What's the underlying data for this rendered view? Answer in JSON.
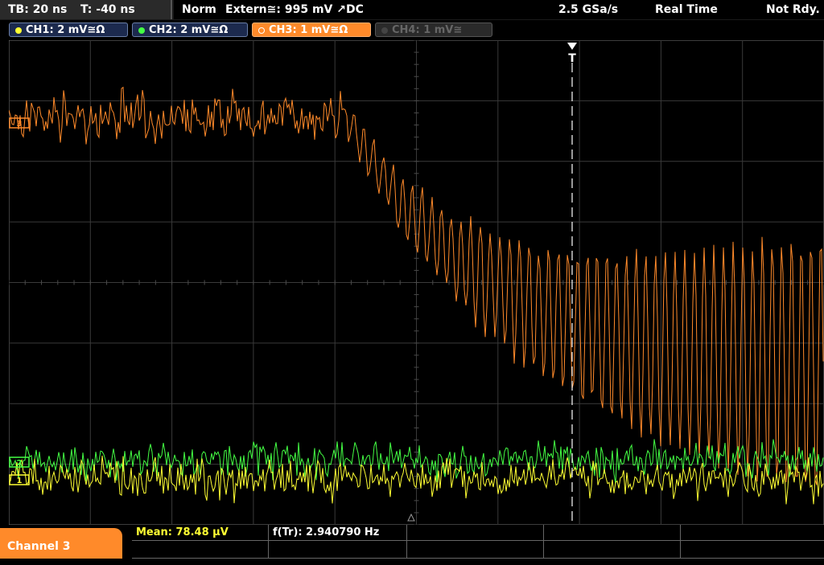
{
  "topbar": {
    "timebase": "TB: 20 ns",
    "trigger_time": "T: -40 ns",
    "trigger_mode": "Norm",
    "trigger_source": "Extern≅: 995 mV ↗DC",
    "sample_rate": "2.5 GSa/s",
    "acquisition_mode": "Real Time",
    "ready_state": "Not Rdy."
  },
  "channels": [
    {
      "label": "CH1: 2 mV≅Ω",
      "color": "#ffff33",
      "active": true
    },
    {
      "label": "CH2: 2 mV≅Ω",
      "color": "#44ff44",
      "active": true
    },
    {
      "label": "CH3: 1 mV≅Ω",
      "color": "#ff8a2a",
      "active": true,
      "selected": true
    },
    {
      "label": "CH4: 1 mV≅",
      "color": "#555555",
      "active": false
    }
  ],
  "markers": {
    "trigger": "T",
    "ch1": "1",
    "ch2": "2",
    "ch3": "3"
  },
  "bottombar": {
    "channel_tab": "Channel 3",
    "mean": "Mean: 78.48 µV",
    "frequency": "f(Tr): 2.940790 Hz"
  },
  "colors": {
    "ch1": "#ffff33",
    "ch2": "#44ff44",
    "ch3": "#ff8a2a",
    "grid": "#555555"
  }
}
